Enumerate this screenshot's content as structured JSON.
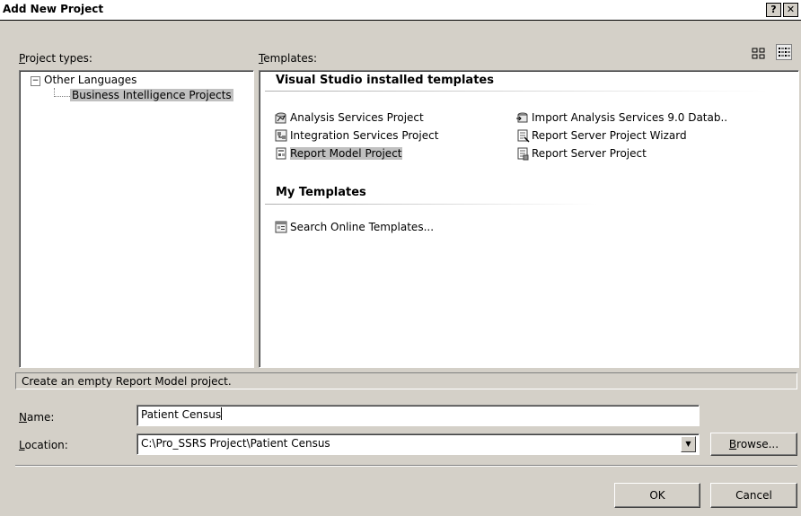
{
  "dialog": {
    "title": "Add New Project",
    "help_btn": "?",
    "close_btn": "✕"
  },
  "labels": {
    "project_types": "Project types:",
    "templates": "Templates:"
  },
  "project_tree": {
    "root": "Other Languages",
    "root_expander": "−",
    "child": "Business Intelligence Projects"
  },
  "templates": {
    "section_installed": "Visual Studio installed templates",
    "section_my": "My Templates",
    "installed_left": [
      {
        "label": "Analysis Services Project",
        "icon": "analysis-services-icon"
      },
      {
        "label": "Integration Services Project",
        "icon": "integration-services-icon"
      },
      {
        "label": "Report Model Project",
        "icon": "report-model-icon",
        "selected": true
      }
    ],
    "installed_right": [
      {
        "label": "Import Analysis Services 9.0 Datab..",
        "icon": "import-analysis-icon"
      },
      {
        "label": "Report Server Project Wizard",
        "icon": "report-wizard-icon"
      },
      {
        "label": "Report Server Project",
        "icon": "report-server-icon"
      }
    ],
    "my": [
      {
        "label": "Search Online Templates...",
        "icon": "search-online-icon"
      }
    ]
  },
  "description": "Create an empty Report Model project.",
  "form": {
    "name_label": "Name:",
    "name_value": "Patient Census",
    "location_label": "Location:",
    "location_value": "C:\\Pro_SSRS Project\\Patient Census",
    "browse_label": "Browse..."
  },
  "buttons": {
    "ok": "OK",
    "cancel": "Cancel"
  },
  "colors": {
    "selection": "#c0c0c0",
    "dialog_bg": "#d4d0c8"
  }
}
